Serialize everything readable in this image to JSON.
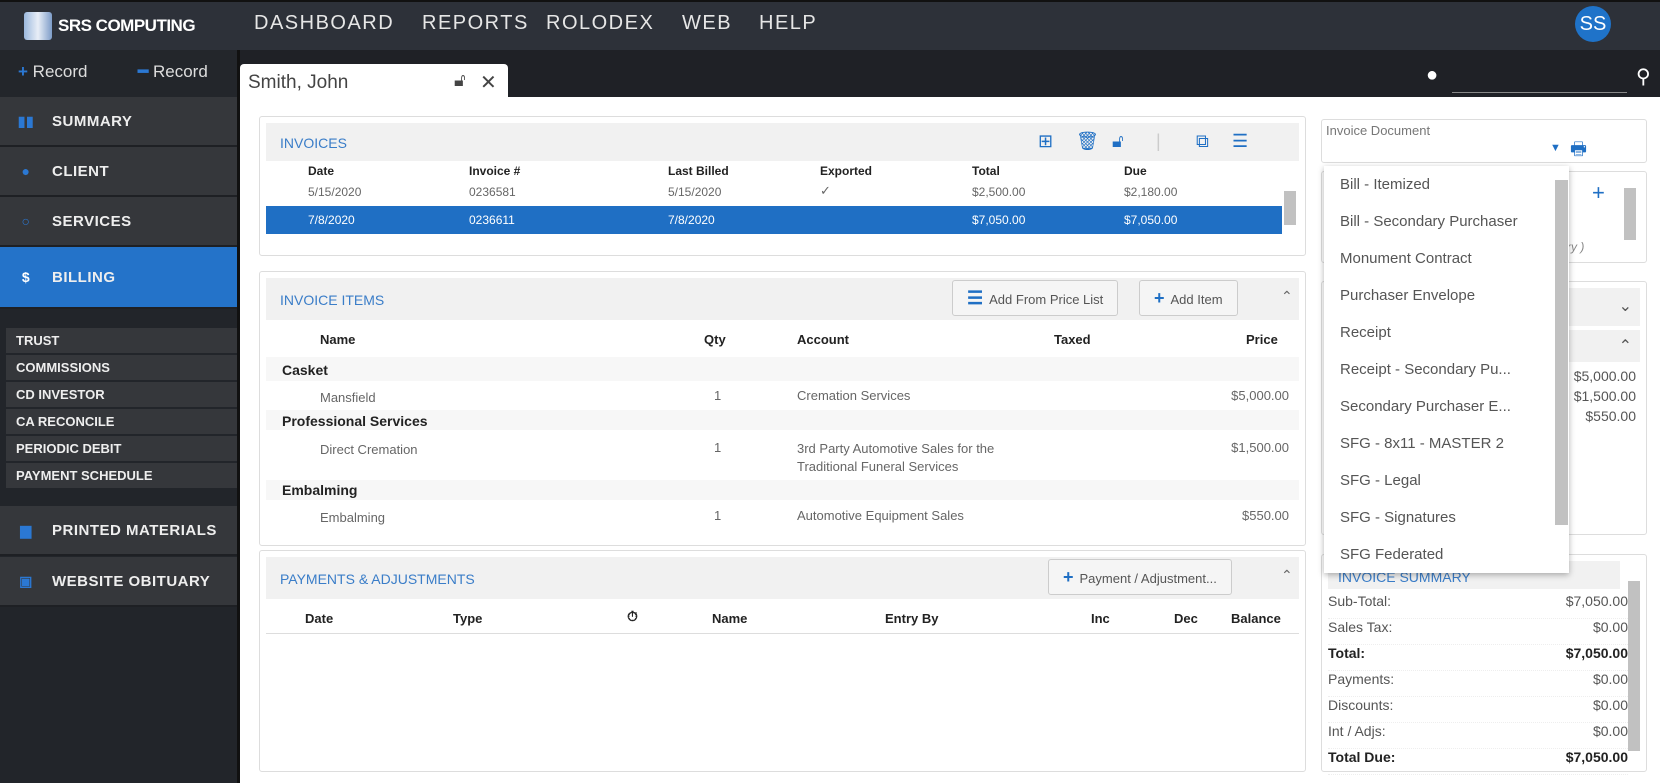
{
  "app": {
    "logo": "SRS COMPUTING",
    "nav": [
      "DASHBOARD",
      "REPORTS",
      "ROLODEX",
      "WEB",
      "HELP"
    ],
    "avatar": "SS"
  },
  "sidebar": {
    "add_record": "Record",
    "remove_record": "Record",
    "items": [
      {
        "label": "SUMMARY",
        "icon": "bars-icon"
      },
      {
        "label": "CLIENT",
        "icon": "person-icon"
      },
      {
        "label": "SERVICES",
        "icon": "circle-icon"
      },
      {
        "label": "BILLING",
        "icon": "dollar-icon"
      }
    ],
    "subitems": [
      "TRUST",
      "COMMISSIONS",
      "CD INVESTOR",
      "CA RECONCILE",
      "PERIODIC DEBIT",
      "PAYMENT SCHEDULE"
    ],
    "bottom": [
      {
        "label": "PRINTED MATERIALS",
        "icon": "printer-icon"
      },
      {
        "label": "WEBSITE OBITUARY",
        "icon": "web-icon"
      }
    ]
  },
  "tab": {
    "label": "Smith, John"
  },
  "invoices": {
    "title": "INVOICES",
    "columns": [
      "Date",
      "Invoice #",
      "Last Billed",
      "Exported",
      "Total",
      "Due"
    ],
    "rows": [
      {
        "date": "5/15/2020",
        "num": "0236581",
        "billed": "5/15/2020",
        "exported": "✓",
        "total": "$2,500.00",
        "due": "$2,180.00"
      },
      {
        "date": "7/8/2020",
        "num": "0236611",
        "billed": "7/8/2020",
        "exported": "",
        "total": "$7,050.00",
        "due": "$7,050.00",
        "selected": true
      }
    ]
  },
  "items": {
    "title": "INVOICE ITEMS",
    "add_price_list": "Add From Price List",
    "add_item": "Add Item",
    "columns": [
      "Name",
      "Qty",
      "Account",
      "Taxed",
      "Price"
    ],
    "groups": [
      {
        "name": "Casket",
        "items": [
          {
            "name": "Mansfield",
            "qty": "1",
            "account": "Cremation Services",
            "price": "$5,000.00"
          }
        ]
      },
      {
        "name": "Professional Services",
        "items": [
          {
            "name": "Direct Cremation",
            "qty": "1",
            "account": "3rd Party Automotive Sales for the Traditional Funeral Services",
            "price": "$1,500.00"
          }
        ]
      },
      {
        "name": "Embalming",
        "items": [
          {
            "name": "Embalming",
            "qty": "1",
            "account": "Automotive Equipment Sales",
            "price": "$550.00"
          }
        ]
      }
    ]
  },
  "payments": {
    "title": "PAYMENTS & ADJUSTMENTS",
    "add": "Payment / Adjustment...",
    "columns": [
      "Date",
      "Type",
      "⏱",
      "Name",
      "Entry By",
      "Inc",
      "Dec",
      "Balance"
    ]
  },
  "invoice_document": {
    "label": "Invoice Document",
    "options": [
      "Bill - Itemized",
      "Bill - Secondary Purchaser",
      "Monument Contract",
      "Purchaser Envelope",
      "Receipt",
      "Receipt - Secondary Pu...",
      "Secondary Purchaser E...",
      "SFG - 8x11 - MASTER 2",
      "SFG - Legal",
      "SFG - Signatures",
      "SFG Federated"
    ]
  },
  "right_partial": {
    "hint": "ry )",
    "prices": [
      "$5,000.00",
      "$1,500.00",
      "$550.00"
    ]
  },
  "summary": {
    "title": "INVOICE SUMMARY",
    "rows": [
      {
        "label": "Sub-Total:",
        "value": "$7,050.00"
      },
      {
        "label": "Sales Tax:",
        "value": "$0.00"
      },
      {
        "label": "Total:",
        "value": "$7,050.00",
        "bold": true
      },
      {
        "label": "Payments:",
        "value": "$0.00"
      },
      {
        "label": "Discounts:",
        "value": "$0.00"
      },
      {
        "label": "Int / Adjs:",
        "value": "$0.00"
      },
      {
        "label": "Total Due:",
        "value": "$7,050.00",
        "bold": true
      }
    ]
  },
  "colors": {
    "accent": "#2473c9",
    "topbar": "#2d3139",
    "sidebar": "#35373b"
  }
}
